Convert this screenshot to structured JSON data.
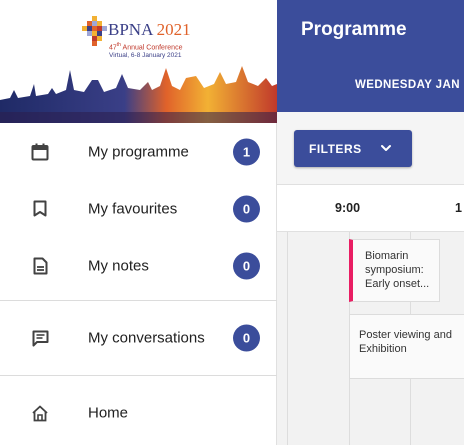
{
  "branding": {
    "name": "BPNA",
    "year": "2021",
    "subtitle_ordinal": "47",
    "subtitle_ordinal_suffix": "th",
    "subtitle_text": "Annual Conference",
    "dates_text": "Virtual, 6-8 January 2021"
  },
  "sidebar": {
    "items": [
      {
        "label": "My programme",
        "count": "1",
        "icon": "calendar-icon"
      },
      {
        "label": "My favourites",
        "count": "0",
        "icon": "bookmark-icon"
      },
      {
        "label": "My notes",
        "count": "0",
        "icon": "document-icon"
      },
      {
        "label": "My conversations",
        "count": "0",
        "icon": "chat-icon"
      },
      {
        "label": "Home",
        "icon": "home-icon"
      }
    ]
  },
  "header": {
    "title": "Programme",
    "day_tab": "WEDNESDAY JAN"
  },
  "filters": {
    "label": "FILTERS"
  },
  "timeline": {
    "slots": [
      "9:00",
      "1"
    ]
  },
  "sessions": [
    {
      "title": "Biomarin symposium: Early onset...",
      "lines": [
        "Biomarin",
        "symposium:",
        "Early onset..."
      ],
      "accent": "#e91e63"
    },
    {
      "title": "Poster viewing and Exhibition",
      "lines": [
        "Poster viewing and",
        "Exhibition"
      ]
    }
  ],
  "colors": {
    "primary": "#3b4d9b",
    "accent": "#e91e63",
    "brand_orange": "#e0622a"
  }
}
